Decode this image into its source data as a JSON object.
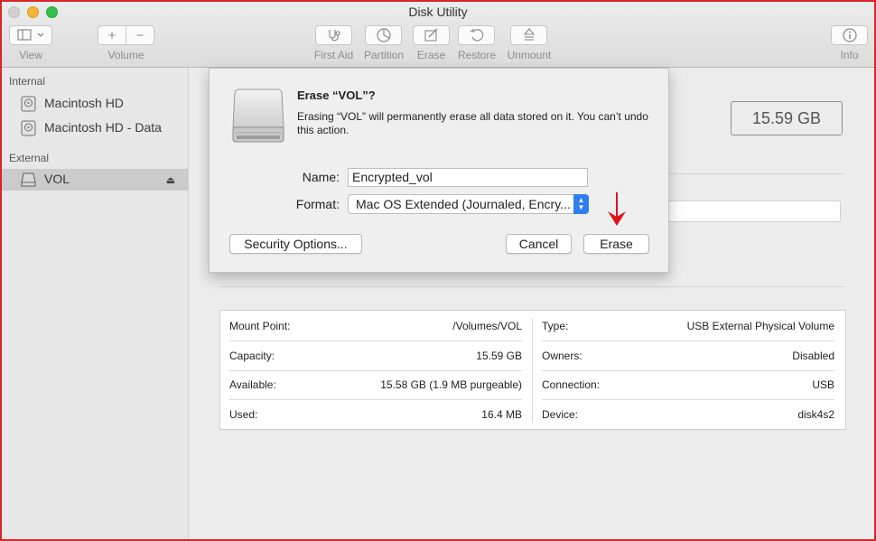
{
  "window": {
    "title": "Disk Utility"
  },
  "toolbar": {
    "view_label": "View",
    "volume_label": "Volume",
    "add_symbol": "+",
    "remove_symbol": "−",
    "first_aid_label": "First Aid",
    "partition_label": "Partition",
    "erase_label": "Erase",
    "restore_label": "Restore",
    "unmount_label": "Unmount",
    "info_label": "Info"
  },
  "sidebar": {
    "internal_header": "Internal",
    "external_header": "External",
    "items": [
      {
        "label": "Macintosh HD"
      },
      {
        "label": "Macintosh HD - Data"
      },
      {
        "label": "VOL",
        "selected": true
      }
    ],
    "eject_symbol": "⏏"
  },
  "main": {
    "capacity_badge": "15.59 GB",
    "info": {
      "left": [
        {
          "key": "Mount Point:",
          "value": "/Volumes/VOL"
        },
        {
          "key": "Capacity:",
          "value": "15.59 GB"
        },
        {
          "key": "Available:",
          "value": "15.58 GB (1.9 MB purgeable)"
        },
        {
          "key": "Used:",
          "value": "16.4 MB"
        }
      ],
      "right": [
        {
          "key": "Type:",
          "value": "USB External Physical Volume"
        },
        {
          "key": "Owners:",
          "value": "Disabled"
        },
        {
          "key": "Connection:",
          "value": "USB"
        },
        {
          "key": "Device:",
          "value": "disk4s2"
        }
      ]
    }
  },
  "dialog": {
    "title": "Erase “VOL”?",
    "message": "Erasing “VOL” will permanently erase all data stored on it. You can’t undo this action.",
    "name_label": "Name:",
    "name_value": "Encrypted_vol",
    "format_label": "Format:",
    "format_value": "Mac OS Extended (Journaled, Encry...",
    "security_button": "Security Options...",
    "cancel_button": "Cancel",
    "erase_button": "Erase"
  },
  "colors": {
    "annotation_arrow": "#e0121b",
    "popup_accent": "#2f7ef2",
    "frame_border": "#d9252a"
  }
}
